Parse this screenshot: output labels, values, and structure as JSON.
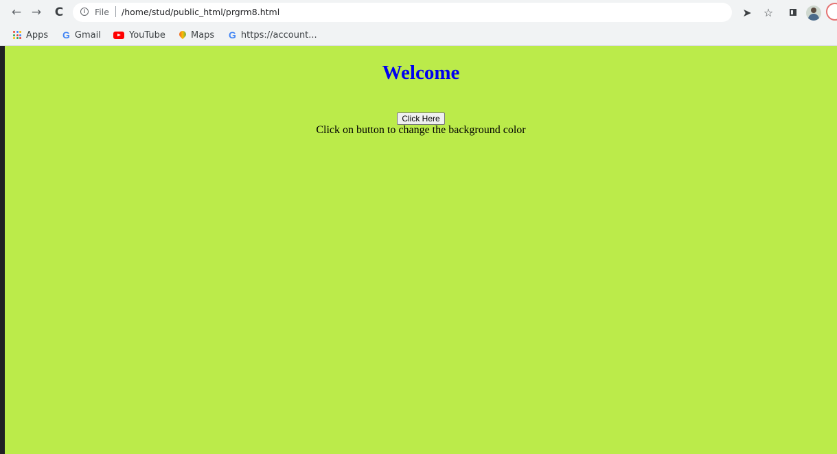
{
  "browser": {
    "scheme_label": "File",
    "url": "/home/stud/public_html/prgrm8.html",
    "nav": {
      "back_icon": "←",
      "forward_icon": "→",
      "reload_icon": "C"
    },
    "star_icon": "☆",
    "share_icon": "➤"
  },
  "bookmarks": [
    {
      "label": "Apps",
      "icon": "apps-grid-icon"
    },
    {
      "label": "Gmail",
      "icon": "google-icon"
    },
    {
      "label": "YouTube",
      "icon": "youtube-icon"
    },
    {
      "label": "Maps",
      "icon": "maps-icon"
    },
    {
      "label": "https://account...",
      "icon": "google-icon"
    }
  ],
  "page": {
    "heading": "Welcome",
    "button_label": "Click Here",
    "message": "Click on button to change the background color",
    "background_color": "#bbeb4a",
    "heading_color": "#0000f0"
  }
}
